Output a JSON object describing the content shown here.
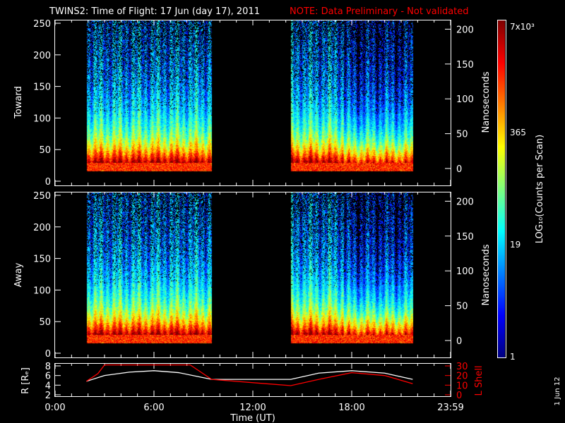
{
  "title": "TWINS2: Time of Flight: 17 Jun (day  17), 2011",
  "note": "NOTE: Data Preliminary - Not validated",
  "date_stamp": "1 Jun 12",
  "colors": {
    "note": "#ff0000",
    "l_shell": "#ff0000",
    "r": "#ffffff"
  },
  "chart_data": [
    {
      "type": "heatmap",
      "panel": "Toward",
      "ylabel": "Toward",
      "ylim": [
        0,
        250
      ],
      "yticks": [
        "0",
        "50",
        "100",
        "150",
        "200",
        "250"
      ],
      "y2label": "Nanoseconds",
      "y2ticks": [
        "0",
        "50",
        "100",
        "150",
        "200"
      ],
      "data_intervals_hours": [
        [
          1.9,
          9.5
        ],
        [
          14.3,
          21.7
        ]
      ]
    },
    {
      "type": "heatmap",
      "panel": "Away",
      "ylabel": "Away",
      "ylim": [
        0,
        250
      ],
      "yticks": [
        "0",
        "50",
        "100",
        "150",
        "200",
        "250"
      ],
      "y2label": "Nanoseconds",
      "y2ticks": [
        "0",
        "50",
        "100",
        "150",
        "200"
      ],
      "data_intervals_hours": [
        [
          1.9,
          9.5
        ],
        [
          14.3,
          21.7
        ]
      ]
    },
    {
      "type": "line",
      "ylabel": "R [Rₑ]",
      "ylim": [
        2,
        8
      ],
      "yticks": [
        "2",
        "4",
        "6",
        "8"
      ],
      "y2label": "L Shell",
      "y2lim": [
        0,
        30
      ],
      "y2ticks": [
        "0",
        "10",
        "20",
        "30"
      ],
      "xlabel": "Time (UT)",
      "xticks": [
        "0:00",
        "6:00",
        "12:00",
        "18:00",
        "23:59"
      ],
      "xtick_hours": [
        0,
        6,
        12,
        18,
        24
      ],
      "series": [
        {
          "name": "R",
          "x": [
            1.9,
            3,
            4.5,
            6,
            7.5,
            9.5,
            14.3,
            16,
            18,
            20,
            21.7
          ],
          "values": [
            4.8,
            6.0,
            6.7,
            7.0,
            6.6,
            5.2,
            5.2,
            6.5,
            7.0,
            6.5,
            5.2
          ]
        },
        {
          "name": "L Shell",
          "x": [
            1.9,
            2.6,
            3.0,
            8.2,
            9.5,
            14.3,
            16,
            18,
            20,
            21.7
          ],
          "values": [
            14,
            22,
            31,
            31,
            16,
            9.5,
            16,
            23,
            20,
            11.5
          ]
        }
      ]
    },
    {
      "type": "colorbar",
      "label": "LOG₁₀(Counts per Scan)",
      "ticks": [
        "1",
        "19",
        "365",
        "7x10³"
      ]
    }
  ]
}
